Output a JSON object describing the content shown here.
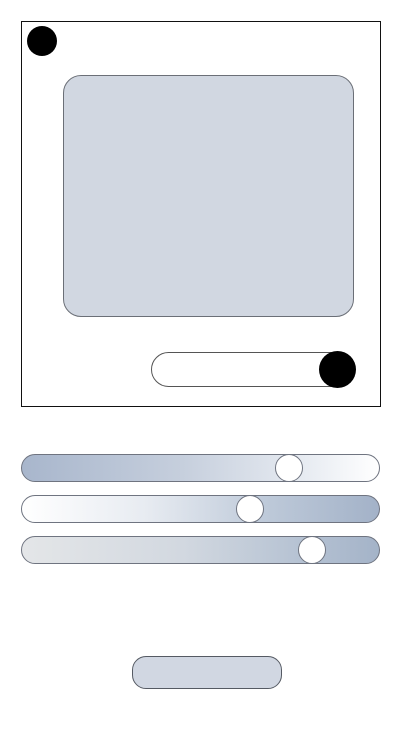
{
  "colors": {
    "panel_fill": "#d1d7e1",
    "button_fill": "#d1d7e2",
    "slider_accent": "#a4b3c8",
    "knob": "#000000"
  },
  "toggle": {
    "state": "on"
  },
  "sliders": [
    {
      "level": 0.77
    },
    {
      "level": 0.65
    },
    {
      "level": 0.84
    }
  ],
  "action_button": {
    "label": ""
  }
}
